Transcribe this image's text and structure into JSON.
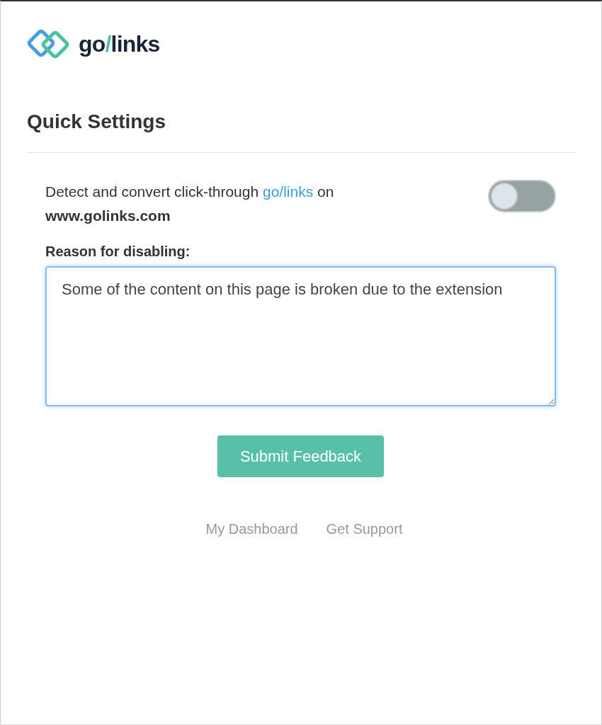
{
  "logo": {
    "parts": [
      "go",
      "/",
      "links"
    ]
  },
  "title": "Quick Settings",
  "setting": {
    "text_before": "Detect and convert click-through ",
    "link": "go/links",
    "text_after": " on",
    "domain": "www.golinks.com",
    "on": false
  },
  "reason": {
    "label": "Reason for disabling:",
    "value": "Some of the content on this page is broken due to the extension"
  },
  "submit_button": "Submit Feedback",
  "footer_links": [
    "My Dashboard",
    "Get Support"
  ]
}
